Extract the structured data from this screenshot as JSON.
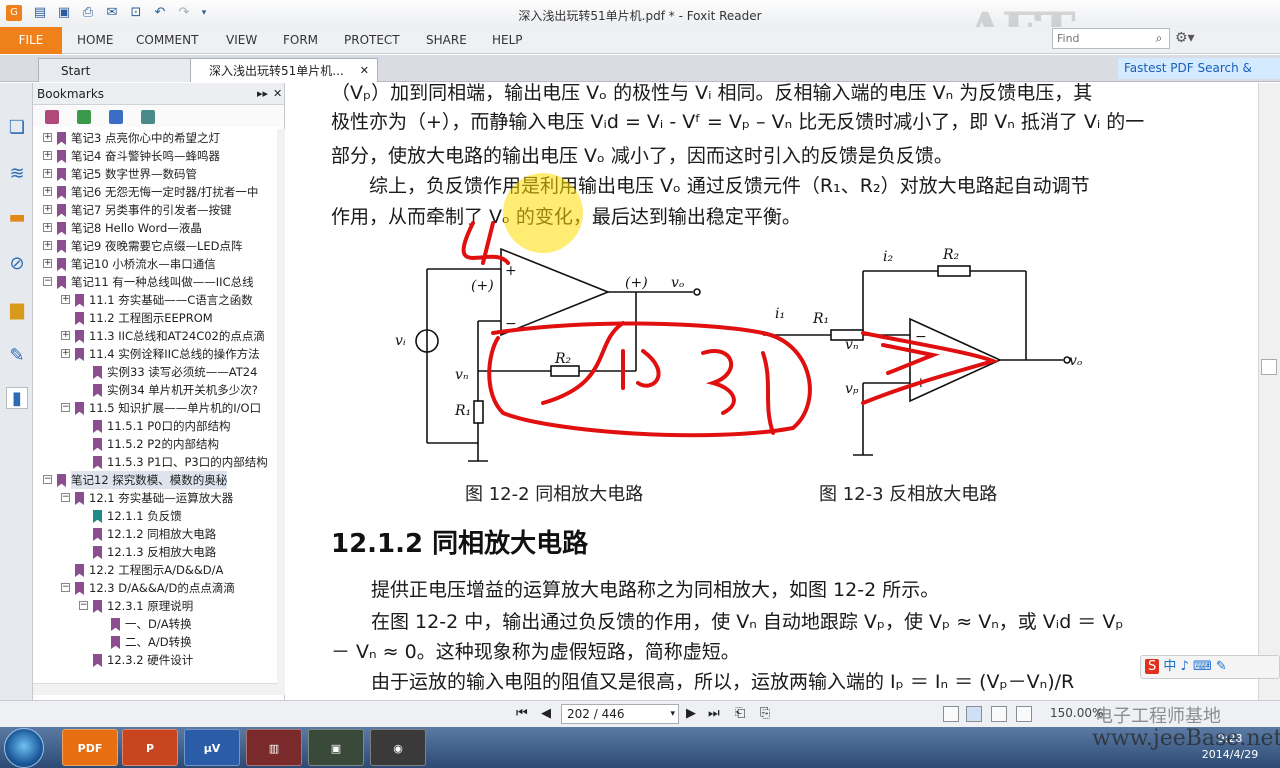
{
  "window": {
    "title": "深入浅出玩转51单片机.pdf * - Foxit Reader"
  },
  "ribbon": {
    "file": "FILE",
    "tabs": [
      "HOME",
      "COMMENT",
      "VIEW",
      "FORM",
      "PROTECT",
      "SHARE",
      "HELP"
    ],
    "search_placeholder": "Find"
  },
  "doc_tabs": {
    "start": "Start",
    "active": "深入浅出玩转51单片机...",
    "promo": "Fastest PDF Search & Index"
  },
  "bookmarks": {
    "title": "Bookmarks",
    "items": [
      {
        "label": "笔记3 点亮你心中的希望之灯",
        "level": 0,
        "exp": "+"
      },
      {
        "label": "笔记4 奋斗警钟长鸣—蜂鸣器",
        "level": 0,
        "exp": "+"
      },
      {
        "label": "笔记5 数字世界—数码管",
        "level": 0,
        "exp": "+"
      },
      {
        "label": "笔记6 无怨无悔一定时器/打扰者一中",
        "level": 0,
        "exp": "+"
      },
      {
        "label": "笔记7 另类事件的引发者—按键",
        "level": 0,
        "exp": "+"
      },
      {
        "label": "笔记8 Hello Word—液晶",
        "level": 0,
        "exp": "+"
      },
      {
        "label": "笔记9 夜晚需要它点缀—LED点阵",
        "level": 0,
        "exp": "+"
      },
      {
        "label": "笔记10 小桥流水—串口通信",
        "level": 0,
        "exp": "+"
      },
      {
        "label": "笔记11 有一种总线叫做——IIC总线",
        "level": 0,
        "exp": "−"
      },
      {
        "label": "11.1 夯实基础——C语言之函数",
        "level": 1,
        "exp": "+"
      },
      {
        "label": "11.2 工程图示EEPROM",
        "level": 1,
        "exp": ""
      },
      {
        "label": "11.3 IIC总线和AT24C02的点点滴",
        "level": 1,
        "exp": "+"
      },
      {
        "label": "11.4 实例诠释IIC总线的操作方法",
        "level": 1,
        "exp": "+"
      },
      {
        "label": "实例33 读写必须统——AT24",
        "level": 2,
        "exp": ""
      },
      {
        "label": "实例34 单片机开关机多少次?",
        "level": 2,
        "exp": ""
      },
      {
        "label": "11.5 知识扩展——单片机的I/O口",
        "level": 1,
        "exp": "−"
      },
      {
        "label": "11.5.1 P0口的内部结构",
        "level": 2,
        "exp": ""
      },
      {
        "label": "11.5.2 P2的内部结构",
        "level": 2,
        "exp": ""
      },
      {
        "label": "11.5.3 P1口、P3口的内部结构",
        "level": 2,
        "exp": ""
      },
      {
        "label": "笔记12 探究数模、模数的奥秘",
        "level": 0,
        "exp": "−",
        "selected": true
      },
      {
        "label": "12.1 夯实基础—运算放大器",
        "level": 1,
        "exp": "−"
      },
      {
        "label": "12.1.1 负反馈",
        "level": 2,
        "exp": "",
        "teal": true
      },
      {
        "label": "12.1.2 同相放大电路",
        "level": 2,
        "exp": ""
      },
      {
        "label": "12.1.3 反相放大电路",
        "level": 2,
        "exp": ""
      },
      {
        "label": "12.2 工程图示A/D&&D/A",
        "level": 1,
        "exp": ""
      },
      {
        "label": "12.3 D/A&&A/D的点点滴滴",
        "level": 1,
        "exp": "−"
      },
      {
        "label": "12.3.1 原理说明",
        "level": 2,
        "exp": "−"
      },
      {
        "label": "一、D/A转换",
        "level": 3,
        "exp": ""
      },
      {
        "label": "二、A/D转换",
        "level": 3,
        "exp": ""
      },
      {
        "label": "12.3.2 硬件设计",
        "level": 2,
        "exp": ""
      }
    ]
  },
  "document": {
    "lines": [
      "（Vₚ）加到同相端，输出电压 Vₒ 的极性与 Vᵢ 相同。反相输入端的电压 Vₙ 为反馈电压，其",
      "极性亦为（+），而静输入电压 Vᵢd = Vᵢ - Vᶠ = Vₚ – Vₙ 比无反馈时减小了，即 Vₙ 抵消了 Vᵢ 的一",
      "部分，使放大电路的输出电压 Vₒ 减小了，因而这时引入的反馈是负反馈。",
      "综上，负反馈作用是利用输出电压 Vₒ 通过反馈元件（R₁、R₂）对放大电路起自动调节",
      "作用，从而牵制了 Vₒ 的变化，最后达到输出稳定平衡。"
    ],
    "fig_left_caption": "图 12-2 同相放大电路",
    "fig_right_caption": "图 12-3 反相放大电路",
    "heading": "12.1.2 同相放大电路",
    "body": [
      "提供正电压增益的运算放大电路称之为同相放大，如图 12-2 所示。",
      "在图 12-2 中，输出通过负反馈的作用，使 Vₙ 自动地跟踪 Vₚ，使 Vₚ ≈ Vₙ，或 Vᵢd ＝ Vₚ",
      "－ Vₙ ≈ 0。这种现象称为虚假短路，简称虚短。",
      "由于运放的输入电阻的阻值又是很高，所以，运放两输入端的 Iₚ ＝ Iₙ ＝ (Vₚ－Vₙ)/R"
    ],
    "circuit_labels": {
      "plus_in": "(+)",
      "out_plus": "(+)",
      "vo": "vₒ",
      "vi": "vᵢ",
      "vn": "vₙ",
      "r1": "R₁",
      "r2": "R₂",
      "i1": "i₁",
      "i2": "i₂",
      "vp": "vₚ"
    }
  },
  "status": {
    "page": "202 / 446",
    "zoom": "150.00%"
  },
  "taskbar": {
    "time": "9:28",
    "date": "2014/4/29"
  },
  "watermark": {
    "logo": "AET",
    "site": "www.jeeBase.net",
    "cn": "电子工程师基地"
  },
  "ime": "中 ♪ ⌨ ✎"
}
